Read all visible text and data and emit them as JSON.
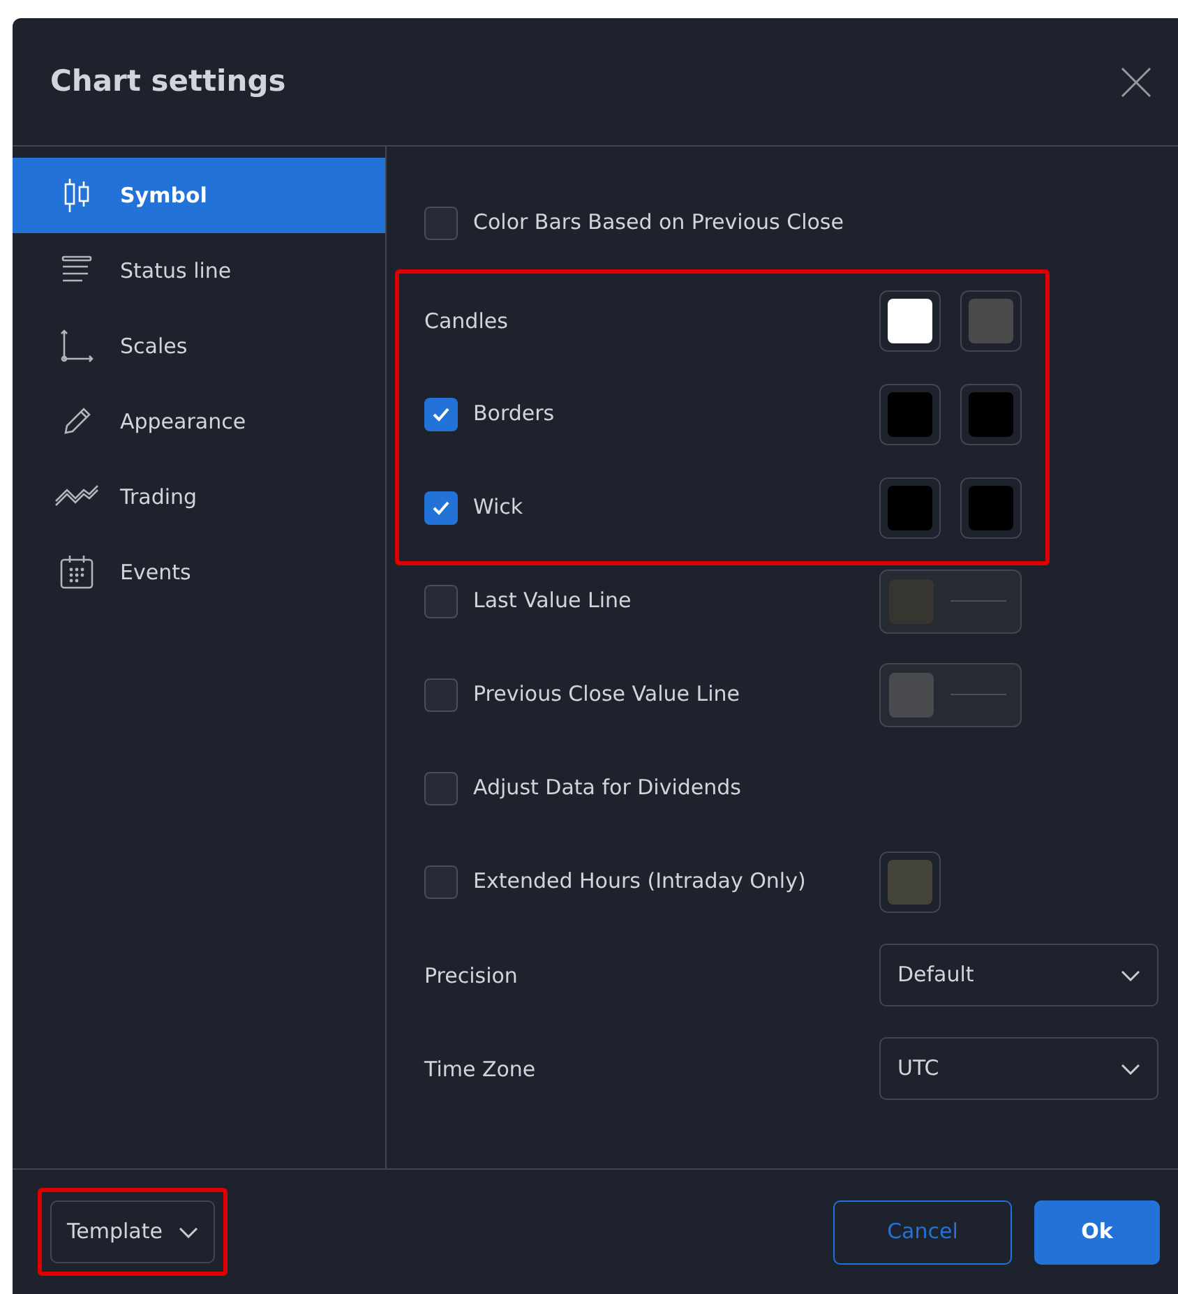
{
  "dialog": {
    "title": "Chart settings"
  },
  "sidebar": {
    "items": [
      {
        "label": "Symbol",
        "selected": true
      },
      {
        "label": "Status line",
        "selected": false
      },
      {
        "label": "Scales",
        "selected": false
      },
      {
        "label": "Appearance",
        "selected": false
      },
      {
        "label": "Trading",
        "selected": false
      },
      {
        "label": "Events",
        "selected": false
      }
    ]
  },
  "sections": [
    {
      "highlighted": false,
      "rows": [
        {
          "kind": "checkbox",
          "label": "Color Bars Based on Previous Close",
          "checked": false
        }
      ]
    },
    {
      "highlighted": true,
      "rows": [
        {
          "kind": "label",
          "label": "Candles",
          "swatches": [
            {
              "kind": "color",
              "color": "#ffffff"
            },
            {
              "kind": "color",
              "color": "#4a4a4a"
            }
          ]
        },
        {
          "kind": "checkbox",
          "label": "Borders",
          "checked": true,
          "swatches": [
            {
              "kind": "color",
              "color": "#000000"
            },
            {
              "kind": "color",
              "color": "#000000"
            }
          ]
        },
        {
          "kind": "checkbox",
          "label": "Wick",
          "checked": true,
          "swatches": [
            {
              "kind": "color",
              "color": "#000000"
            },
            {
              "kind": "color",
              "color": "#000000"
            }
          ]
        }
      ]
    },
    {
      "highlighted": false,
      "rows": [
        {
          "kind": "checkbox",
          "label": "Last Value Line",
          "checked": false,
          "swatches": [
            {
              "kind": "line",
              "color": "#36352f"
            }
          ]
        },
        {
          "kind": "checkbox",
          "label": "Previous Close Value Line",
          "checked": false,
          "swatches": [
            {
              "kind": "line",
              "color": "#4a4b4f"
            }
          ]
        },
        {
          "kind": "checkbox",
          "label": "Adjust Data for Dividends",
          "checked": false
        },
        {
          "kind": "checkbox",
          "label": "Extended Hours (Intraday Only)",
          "checked": false,
          "swatches": [
            {
              "kind": "color",
              "color": "#45443a"
            }
          ]
        },
        {
          "kind": "select",
          "label": "Precision",
          "value": "Default"
        },
        {
          "kind": "select",
          "label": "Time Zone",
          "value": "UTC"
        }
      ]
    }
  ],
  "footer": {
    "template": {
      "label": "Template",
      "highlighted": true
    },
    "buttons": [
      {
        "label": "Cancel",
        "kind": "secondary"
      },
      {
        "label": "Ok",
        "kind": "primary"
      }
    ]
  }
}
